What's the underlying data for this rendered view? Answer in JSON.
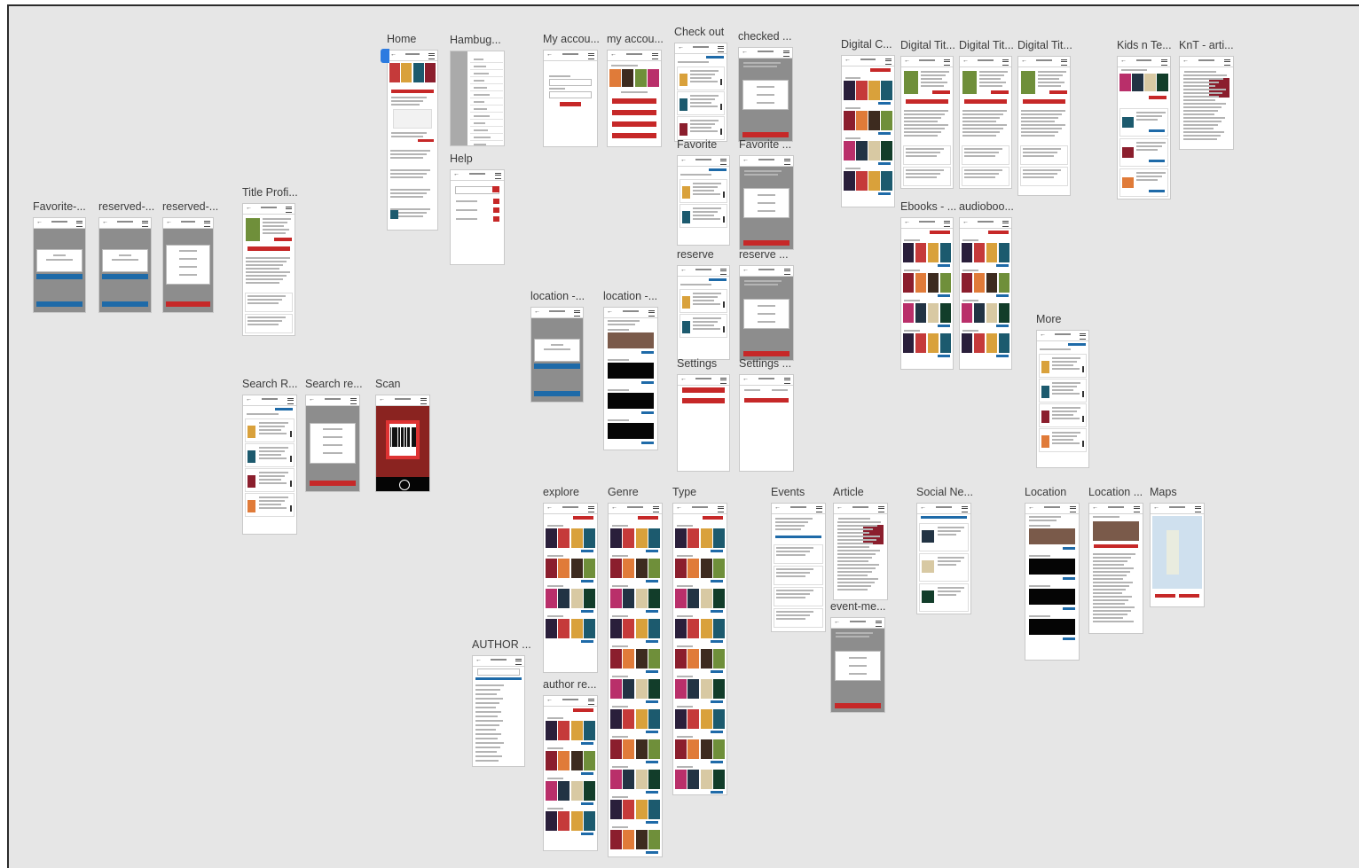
{
  "canvas": {
    "background": "#e6e6e6",
    "accent_red": "#c62828",
    "accent_blue": "#1e6aa8"
  },
  "artboards": [
    {
      "id": "home",
      "label": "Home"
    },
    {
      "id": "hamburger",
      "label": "Hambug..."
    },
    {
      "id": "my-account-login",
      "label": "My accou..."
    },
    {
      "id": "my-account",
      "label": "my accou..."
    },
    {
      "id": "check-out",
      "label": "Check out"
    },
    {
      "id": "checked-out",
      "label": "checked ..."
    },
    {
      "id": "digital-collection",
      "label": "Digital C..."
    },
    {
      "id": "digital-title-1",
      "label": "Digital Tit..."
    },
    {
      "id": "digital-title-2",
      "label": "Digital Tit..."
    },
    {
      "id": "digital-title-3",
      "label": "Digital Tit..."
    },
    {
      "id": "kids-teens",
      "label": "Kids n Te..."
    },
    {
      "id": "knt-article",
      "label": "KnT - arti..."
    },
    {
      "id": "help",
      "label": "Help"
    },
    {
      "id": "favorite",
      "label": "Favorite"
    },
    {
      "id": "favorite-2",
      "label": "Favorite ..."
    },
    {
      "id": "title-profile",
      "label": "Title Profi..."
    },
    {
      "id": "favorite-dialog",
      "label": "Favorite-..."
    },
    {
      "id": "reserved-1",
      "label": "reserved-..."
    },
    {
      "id": "reserved-2",
      "label": "reserved-..."
    },
    {
      "id": "ebooks",
      "label": "Ebooks - ..."
    },
    {
      "id": "audiobooks",
      "label": "audioboo..."
    },
    {
      "id": "reserve",
      "label": "reserve"
    },
    {
      "id": "reserve-2",
      "label": "reserve ..."
    },
    {
      "id": "location-1",
      "label": "location -..."
    },
    {
      "id": "location-2",
      "label": "location -..."
    },
    {
      "id": "more",
      "label": "More"
    },
    {
      "id": "settings",
      "label": "Settings"
    },
    {
      "id": "settings-2",
      "label": "Settings ..."
    },
    {
      "id": "search-results",
      "label": "Search R..."
    },
    {
      "id": "search-results-2",
      "label": "Search re..."
    },
    {
      "id": "scan",
      "label": "Scan"
    },
    {
      "id": "explore",
      "label": "explore"
    },
    {
      "id": "genre",
      "label": "Genre"
    },
    {
      "id": "type",
      "label": "Type"
    },
    {
      "id": "events",
      "label": "Events"
    },
    {
      "id": "article",
      "label": "Article"
    },
    {
      "id": "social-network",
      "label": "Social Ne..."
    },
    {
      "id": "location",
      "label": "Location"
    },
    {
      "id": "location-profile",
      "label": "Location ..."
    },
    {
      "id": "maps",
      "label": "Maps"
    },
    {
      "id": "event-menu",
      "label": "event-me..."
    },
    {
      "id": "author",
      "label": "AUTHOR ..."
    },
    {
      "id": "author-results",
      "label": "author re..."
    }
  ]
}
